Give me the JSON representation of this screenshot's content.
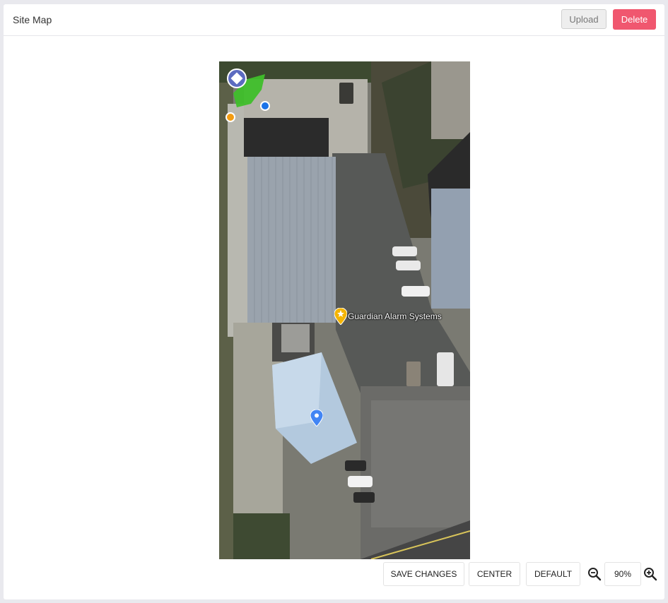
{
  "header": {
    "title": "Site Map",
    "upload_label": "Upload",
    "delete_label": "Delete"
  },
  "map": {
    "poi_label": "Guardian Alarm Systems"
  },
  "toolbar": {
    "save_label": "SAVE CHANGES",
    "center_label": "CENTER",
    "default_label": "DEFAULT",
    "zoom_value": "90%"
  },
  "colors": {
    "delete": "#f0576f",
    "zone_marker": "#5c6bc0",
    "zone_area": "#3fbf2a",
    "device_blue": "#1a73e8",
    "device_orange": "#f39c12",
    "poi": "#f4b400"
  },
  "icons": {
    "zone": "zone-diamond-icon",
    "zoom_out": "zoom-out-icon",
    "zoom_in": "zoom-in-icon",
    "poi": "star-pin-icon",
    "location": "location-pin-icon"
  }
}
